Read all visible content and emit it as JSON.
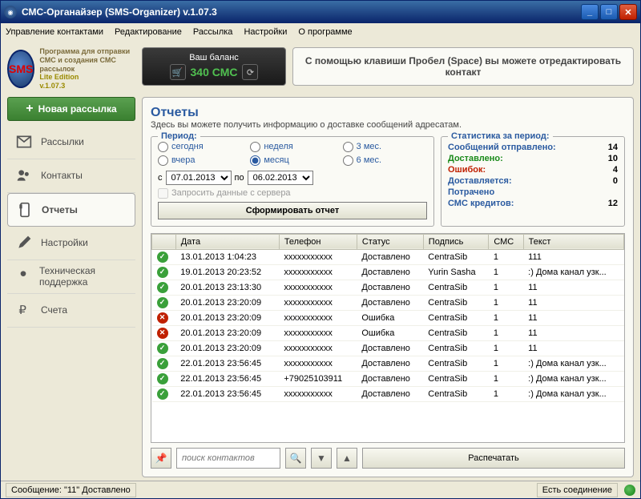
{
  "title": "СМС-Органайзер (SMS-Organizer) v.1.07.3",
  "menu": [
    "Управление контактами",
    "Редактирование",
    "Рассылка",
    "Настройки",
    "О программе"
  ],
  "logo": {
    "tagline": "Программа для отправки СМС и создания СМС рассылок",
    "edition": "Lite Edition",
    "version": "v.1.07.3",
    "badge": "SMS"
  },
  "balance": {
    "title": "Ваш баланс",
    "value": "340 СМС"
  },
  "hint": "С помощью клавиши Пробел (Space) вы можете отредактировать контакт",
  "new_campaign": "Новая рассылка",
  "sidebar": [
    {
      "icon": "mail",
      "label": "Рассылки"
    },
    {
      "icon": "contacts",
      "label": "Контакты"
    },
    {
      "icon": "reports",
      "label": "Отчеты",
      "active": true
    },
    {
      "icon": "settings",
      "label": "Настройки"
    },
    {
      "icon": "support",
      "label": "Техническая поддержка"
    },
    {
      "icon": "billing",
      "label": "Счета"
    }
  ],
  "reports": {
    "title": "Отчеты",
    "subtitle": "Здесь вы можете получить информацию о доставке сообщений адресатам.",
    "period_legend": "Период:",
    "radios": [
      "сегодня",
      "неделя",
      "3 мес.",
      "вчера",
      "месяц",
      "6 мес."
    ],
    "radio_selected": "месяц",
    "from_label": "с",
    "from_date": "07.01.2013",
    "to_label": "по",
    "to_date": "06.02.2013",
    "server_check": "Запросить данные с сервера",
    "gen_button": "Сформировать отчет",
    "stats_legend": "Статистика за период:",
    "stats": {
      "sent_label": "Сообщений отправлено:",
      "sent_val": "14",
      "delivered_label": "Доставлено:",
      "delivered_val": "10",
      "errors_label": "Ошибок:",
      "errors_val": "4",
      "pending_label": "Доставляется:",
      "pending_val": "0",
      "spent_label": "Потрачено",
      "credits_label": "СМС кредитов:",
      "credits_val": "12"
    },
    "columns": [
      "",
      "Дата",
      "Телефон",
      "Статус",
      "Подпись",
      "СМС",
      "Текст"
    ],
    "rows": [
      {
        "ok": true,
        "date": "13.01.2013 1:04:23",
        "phone": "xxxxxxxxxxx",
        "status": "Доставлено",
        "sign": "CentraSib",
        "sms": "1",
        "text": "111"
      },
      {
        "ok": true,
        "date": "19.01.2013 20:23:52",
        "phone": "xxxxxxxxxxx",
        "status": "Доставлено",
        "sign": "Yurin Sasha",
        "sms": "1",
        "text": ":) Дома канал узк..."
      },
      {
        "ok": true,
        "date": "20.01.2013 23:13:30",
        "phone": "xxxxxxxxxxx",
        "status": "Доставлено",
        "sign": "CentraSib",
        "sms": "1",
        "text": "11"
      },
      {
        "ok": true,
        "date": "20.01.2013 23:20:09",
        "phone": "xxxxxxxxxxx",
        "status": "Доставлено",
        "sign": "CentraSib",
        "sms": "1",
        "text": "11"
      },
      {
        "ok": false,
        "date": "20.01.2013 23:20:09",
        "phone": "xxxxxxxxxxx",
        "status": "Ошибка",
        "sign": "CentraSib",
        "sms": "1",
        "text": "11"
      },
      {
        "ok": false,
        "date": "20.01.2013 23:20:09",
        "phone": "xxxxxxxxxxx",
        "status": "Ошибка",
        "sign": "CentraSib",
        "sms": "1",
        "text": "11"
      },
      {
        "ok": true,
        "date": "20.01.2013 23:20:09",
        "phone": "xxxxxxxxxxx",
        "status": "Доставлено",
        "sign": "CentraSib",
        "sms": "1",
        "text": "11"
      },
      {
        "ok": true,
        "date": "22.01.2013 23:56:45",
        "phone": "xxxxxxxxxxx",
        "status": "Доставлено",
        "sign": "CentraSib",
        "sms": "1",
        "text": ":) Дома канал узк..."
      },
      {
        "ok": true,
        "date": "22.01.2013 23:56:45",
        "phone": "+79025103911",
        "status": "Доставлено",
        "sign": "CentraSib",
        "sms": "1",
        "text": ":) Дома канал узк..."
      },
      {
        "ok": true,
        "date": "22.01.2013 23:56:45",
        "phone": "xxxxxxxxxxx",
        "status": "Доставлено",
        "sign": "CentraSib",
        "sms": "1",
        "text": ":) Дома канал узк..."
      }
    ],
    "search_placeholder": "поиск контактов",
    "print": "Распечатать"
  },
  "status": {
    "msg": "Сообщение: \"11\" Доставлено",
    "conn": "Есть соединение"
  }
}
